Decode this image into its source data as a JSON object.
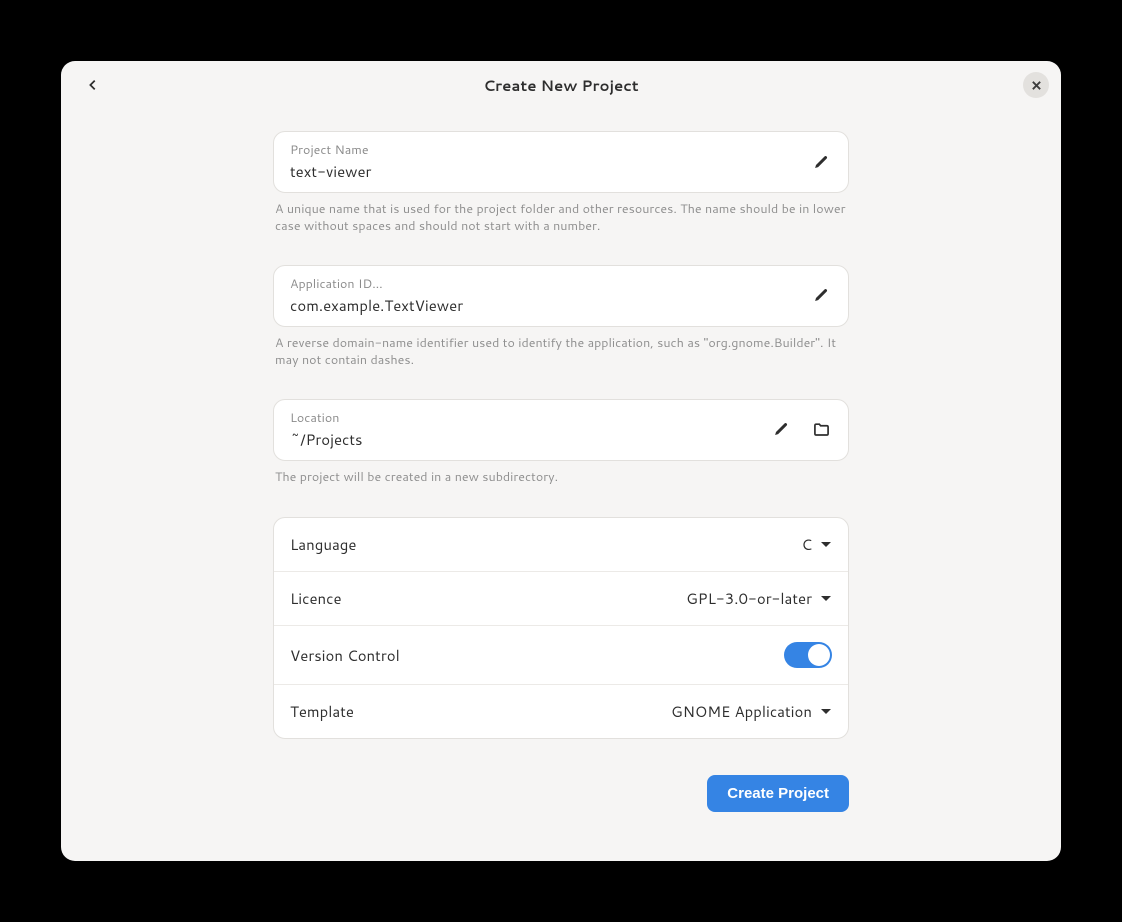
{
  "header": {
    "title": "Create New Project"
  },
  "projectName": {
    "label": "Project Name",
    "value": "text-viewer",
    "hint": "A unique name that is used for the project folder and other resources. The name should be in lower case without spaces and should not start with a number."
  },
  "appId": {
    "label": "Application ID…",
    "value": "com.example.TextViewer",
    "hint": "A reverse domain-name identifier used to identify the application, such as \"org.gnome.Builder\". It may not contain dashes."
  },
  "location": {
    "label": "Location",
    "value": "~/Projects",
    "hint": "The project will be created in a new subdirectory."
  },
  "options": {
    "language": {
      "label": "Language",
      "value": "C"
    },
    "licence": {
      "label": "Licence",
      "value": "GPL-3.0-or-later"
    },
    "versionControl": {
      "label": "Version Control",
      "enabled": true
    },
    "template": {
      "label": "Template",
      "value": "GNOME Application"
    }
  },
  "footer": {
    "createButton": "Create Project"
  }
}
